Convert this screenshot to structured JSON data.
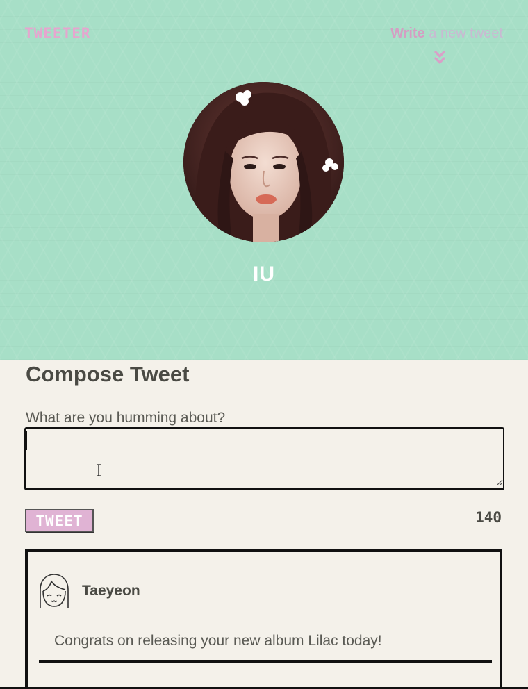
{
  "header": {
    "brand": "TWEETER",
    "write_strong": "Write",
    "write_rest": " a new tweet",
    "chevron_icon": "double-chevron-down-icon",
    "bg_color": "#a7dfc7",
    "accent_color": "#e6a6cf"
  },
  "profile": {
    "name": "IU",
    "avatar": "profile-photo"
  },
  "compose": {
    "title": "Compose Tweet",
    "label": "What are you humming about?",
    "value": "",
    "placeholder": "",
    "button_label": "TWEET",
    "char_count": "140"
  },
  "tweets": [
    {
      "author": "Taeyeon",
      "avatar_icon": "cartoon-face-icon",
      "text": "Congrats on releasing your new album Lilac today!"
    }
  ]
}
